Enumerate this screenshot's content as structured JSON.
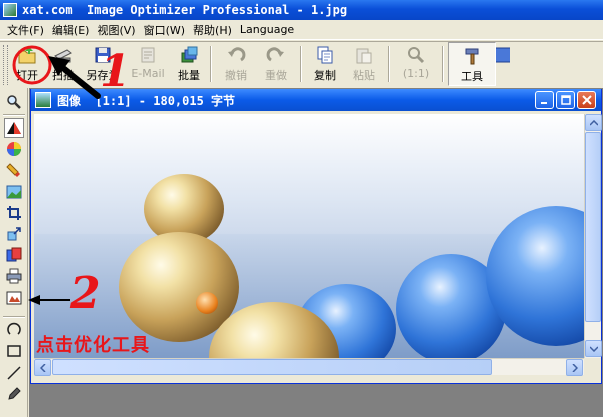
{
  "app": {
    "title": "xat.com  Image Optimizer Professional - 1.jpg"
  },
  "menu": [
    {
      "label": "文件(F)"
    },
    {
      "label": "编辑(E)"
    },
    {
      "label": "视图(V)"
    },
    {
      "label": "窗口(W)"
    },
    {
      "label": "帮助(H)"
    },
    {
      "label": "Language"
    }
  ],
  "toolbar": {
    "open": "打开",
    "scan": "扫描",
    "save_as": "另存为",
    "email": "E-Mail",
    "batch": "批量",
    "undo": "撤销",
    "redo": "重做",
    "copy": "复制",
    "paste": "粘贴",
    "zoom": "(1:1)",
    "tools": "工具"
  },
  "document": {
    "title": "图像  [1:1] - 180,015 字节"
  },
  "annotations": {
    "step1": "1",
    "step2": "2",
    "hint": "点击优化工具"
  },
  "colors": {
    "annotation": "#e8161a",
    "titlebar": "#0a4fd8",
    "face": "#ece9d8"
  }
}
